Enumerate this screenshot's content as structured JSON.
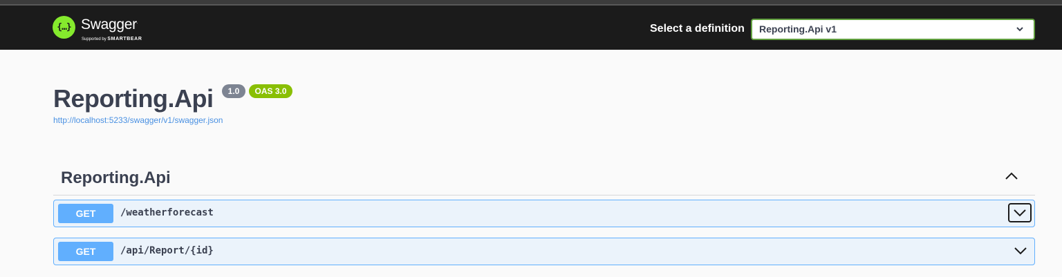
{
  "header": {
    "logo_icon": "swagger-braces-icon",
    "logo_glyph": "{…}",
    "logo_word": "Swagger",
    "logo_trademark": ".",
    "logo_sub_prefix": "Supported by",
    "logo_sub_brand": "SMARTBEAR",
    "definition_label": "Select a definition",
    "definition_selected": "Reporting.Api v1",
    "accent_color": "#85ea2d"
  },
  "info": {
    "title": "Reporting.Api",
    "version_badge": "1.0",
    "oas_badge": "OAS 3.0",
    "spec_url": "http://localhost:5233/swagger/v1/swagger.json"
  },
  "tag": {
    "name": "Reporting.Api",
    "toggle_icon": "chevron-up-icon",
    "operations": [
      {
        "method": "GET",
        "path": "/weatherforecast",
        "toggle_icon": "chevron-down-icon"
      },
      {
        "method": "GET",
        "path": "/api/Report/{id}",
        "toggle_icon": "chevron-down-icon"
      }
    ]
  },
  "colors": {
    "get_method": "#61affe",
    "version_badge": "#7d8492",
    "oas_badge": "#89bf04",
    "link": "#4990e2"
  }
}
